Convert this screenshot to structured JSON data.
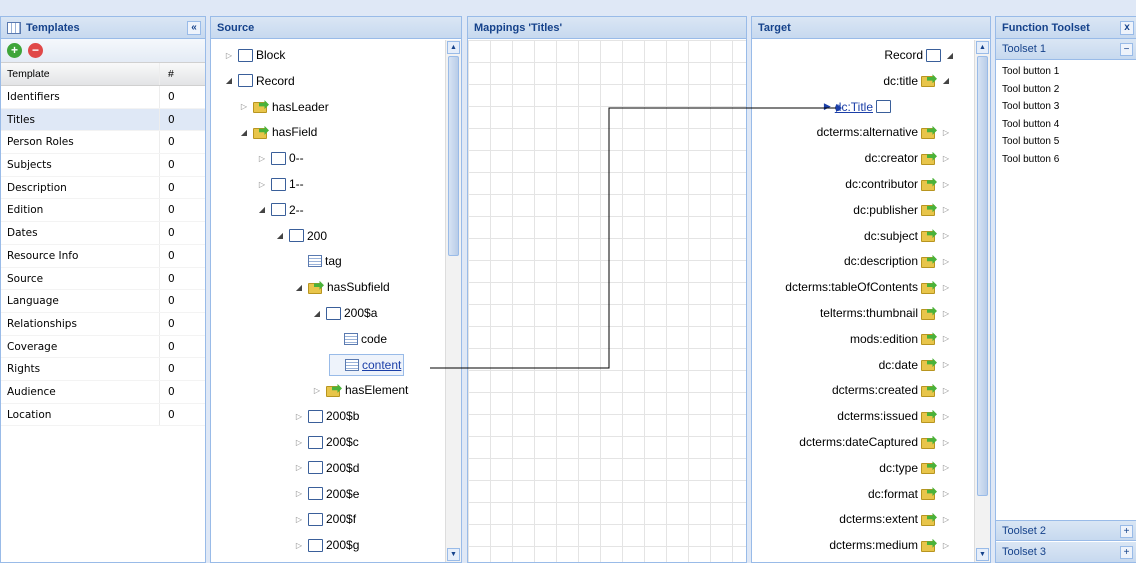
{
  "templates": {
    "title": "Templates",
    "collapse_icon": "«",
    "add_icon": "+",
    "remove_icon": "−",
    "columns": [
      "Template",
      "#"
    ],
    "rows": [
      {
        "name": "Identifiers",
        "count": "0"
      },
      {
        "name": "Titles",
        "count": "0"
      },
      {
        "name": "Person Roles",
        "count": "0"
      },
      {
        "name": "Subjects",
        "count": "0"
      },
      {
        "name": "Description",
        "count": "0"
      },
      {
        "name": "Edition",
        "count": "0"
      },
      {
        "name": "Dates",
        "count": "0"
      },
      {
        "name": "Resource Info",
        "count": "0"
      },
      {
        "name": "Source",
        "count": "0"
      },
      {
        "name": "Language",
        "count": "0"
      },
      {
        "name": "Relationships",
        "count": "0"
      },
      {
        "name": "Coverage",
        "count": "0"
      },
      {
        "name": "Rights",
        "count": "0"
      },
      {
        "name": "Audience",
        "count": "0"
      },
      {
        "name": "Location",
        "count": "0"
      }
    ],
    "selected": "Titles"
  },
  "source": {
    "title": "Source",
    "nodes": [
      {
        "label": "Block",
        "arrow": "closed",
        "icon": "folder-icon"
      },
      {
        "label": "Record",
        "arrow": "open",
        "icon": "folder-icon"
      },
      {
        "label": "hasLeader",
        "arrow": "closed",
        "icon": "relation-icon"
      },
      {
        "label": "hasField",
        "arrow": "open",
        "icon": "relation-icon"
      },
      {
        "label": "0--",
        "arrow": "closed",
        "icon": "folder-icon"
      },
      {
        "label": "1--",
        "arrow": "closed",
        "icon": "folder-icon"
      },
      {
        "label": "2--",
        "arrow": "open",
        "icon": "folder-icon"
      },
      {
        "label": "200",
        "arrow": "open",
        "icon": "folder-icon"
      },
      {
        "label": "tag",
        "arrow": "none",
        "icon": "list-icon"
      },
      {
        "label": "hasSubfield",
        "arrow": "open",
        "icon": "relation-icon"
      },
      {
        "label": "200$a",
        "arrow": "open",
        "icon": "folder-icon"
      },
      {
        "label": "code",
        "arrow": "none",
        "icon": "list-icon"
      },
      {
        "label": "content",
        "arrow": "none",
        "icon": "list-icon",
        "link": true
      },
      {
        "label": "hasElement",
        "arrow": "closed",
        "icon": "relation-icon"
      },
      {
        "label": "200$b",
        "arrow": "closed",
        "icon": "folder-icon"
      },
      {
        "label": "200$c",
        "arrow": "closed",
        "icon": "folder-icon"
      },
      {
        "label": "200$d",
        "arrow": "closed",
        "icon": "folder-icon"
      },
      {
        "label": "200$e",
        "arrow": "closed",
        "icon": "folder-icon"
      },
      {
        "label": "200$f",
        "arrow": "closed",
        "icon": "folder-icon"
      },
      {
        "label": "200$g",
        "arrow": "closed",
        "icon": "folder-icon"
      }
    ]
  },
  "mappings": {
    "title": "Mappings 'Titles'"
  },
  "target": {
    "title": "Target",
    "nodes": [
      {
        "label": "Record",
        "icon": "folder-icon",
        "arrow": "open"
      },
      {
        "label": "dc:title",
        "icon": "relation-icon",
        "arrow": "open"
      },
      {
        "label": "dc:Title",
        "icon": "folder-icon",
        "arrow": "none",
        "link": true
      },
      {
        "label": "dcterms:alternative",
        "icon": "relation-icon",
        "arrow": "closed"
      },
      {
        "label": "dc:creator",
        "icon": "relation-icon",
        "arrow": "closed"
      },
      {
        "label": "dc:contributor",
        "icon": "relation-icon",
        "arrow": "closed"
      },
      {
        "label": "dc:publisher",
        "icon": "relation-icon",
        "arrow": "closed"
      },
      {
        "label": "dc:subject",
        "icon": "relation-icon",
        "arrow": "closed"
      },
      {
        "label": "dc:description",
        "icon": "relation-icon",
        "arrow": "closed"
      },
      {
        "label": "dcterms:tableOfContents",
        "icon": "relation-icon",
        "arrow": "closed"
      },
      {
        "label": "telterms:thumbnail",
        "icon": "relation-icon",
        "arrow": "closed"
      },
      {
        "label": "mods:edition",
        "icon": "relation-icon",
        "arrow": "closed"
      },
      {
        "label": "dc:date",
        "icon": "relation-icon",
        "arrow": "closed"
      },
      {
        "label": "dcterms:created",
        "icon": "relation-icon",
        "arrow": "closed"
      },
      {
        "label": "dcterms:issued",
        "icon": "relation-icon",
        "arrow": "closed"
      },
      {
        "label": "dcterms:dateCaptured",
        "icon": "relation-icon",
        "arrow": "closed"
      },
      {
        "label": "dc:type",
        "icon": "relation-icon",
        "arrow": "closed"
      },
      {
        "label": "dc:format",
        "icon": "relation-icon",
        "arrow": "closed"
      },
      {
        "label": "dcterms:extent",
        "icon": "relation-icon",
        "arrow": "closed"
      },
      {
        "label": "dcterms:medium",
        "icon": "relation-icon",
        "arrow": "closed"
      }
    ]
  },
  "tools": {
    "title": "Function Toolset",
    "close_icon": "x",
    "sections": [
      {
        "label": "Toolset 1",
        "toggle": "−"
      },
      {
        "label": "Toolset 2",
        "toggle": "+"
      },
      {
        "label": "Toolset 3",
        "toggle": "+"
      }
    ],
    "buttons": [
      "Tool button 1",
      "Tool button 2",
      "Tool button 3",
      "Tool button 4",
      "Tool button 5",
      "Tool button 6"
    ]
  },
  "colors": {
    "accent": "#15428b",
    "border": "#99bbe8",
    "selection": "#dfe8f6"
  }
}
